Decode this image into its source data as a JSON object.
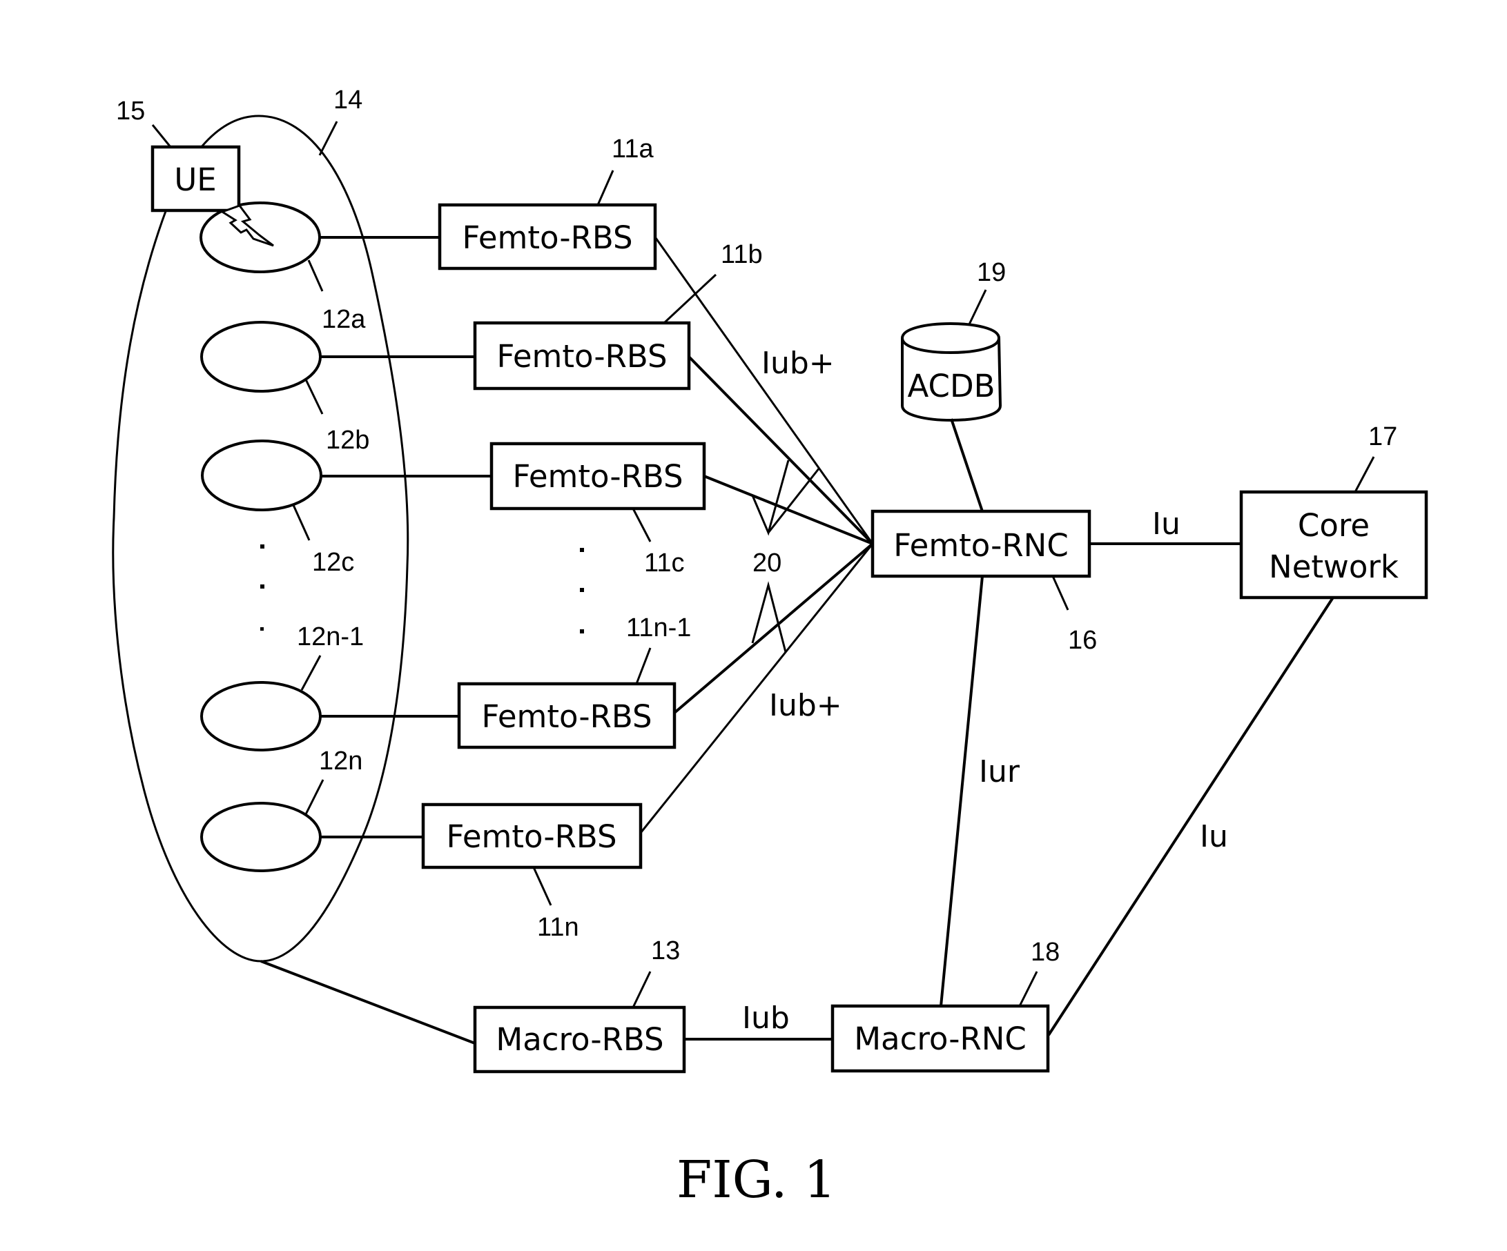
{
  "figure": {
    "caption": "FIG. 1",
    "colors": {
      "ink": "#000000",
      "background": "#ffffff"
    }
  },
  "nodes": {
    "ue": {
      "label": "UE",
      "ref": "15"
    },
    "coverage_area": {
      "ref": "14"
    },
    "femto_cells": [
      {
        "ref": "12a"
      },
      {
        "ref": "12b"
      },
      {
        "ref": "12c"
      },
      {
        "ref": "12n-1"
      },
      {
        "ref": "12n"
      }
    ],
    "femto_rbs": [
      {
        "label": "Femto-RBS",
        "ref": "11a"
      },
      {
        "label": "Femto-RBS",
        "ref": "11b"
      },
      {
        "label": "Femto-RBS",
        "ref": "11c"
      },
      {
        "label": "Femto-RBS",
        "ref": "11n-1"
      },
      {
        "label": "Femto-RBS",
        "ref": "11n"
      }
    ],
    "femto_rnc": {
      "label": "Femto-RNC",
      "ref": "16"
    },
    "acdb": {
      "label": "ACDB",
      "ref": "19"
    },
    "core_network": {
      "label_line1": "Core",
      "label_line2": "Network",
      "ref": "17"
    },
    "macro_rbs": {
      "label": "Macro-RBS",
      "ref": "13"
    },
    "macro_rnc": {
      "label": "Macro-RNC",
      "ref": "18"
    }
  },
  "links": {
    "iub_plus_upper": "Iub+",
    "iub_plus_lower": "Iub+",
    "iub_group_ref": "20",
    "iu_femto_core": "Iu",
    "iur": "Iur",
    "iu_macro_core": "Iu",
    "iub_macro": "Iub"
  },
  "icons": {
    "radio_link": "lightning-bolt",
    "continuation": "vertical-ellipsis"
  }
}
